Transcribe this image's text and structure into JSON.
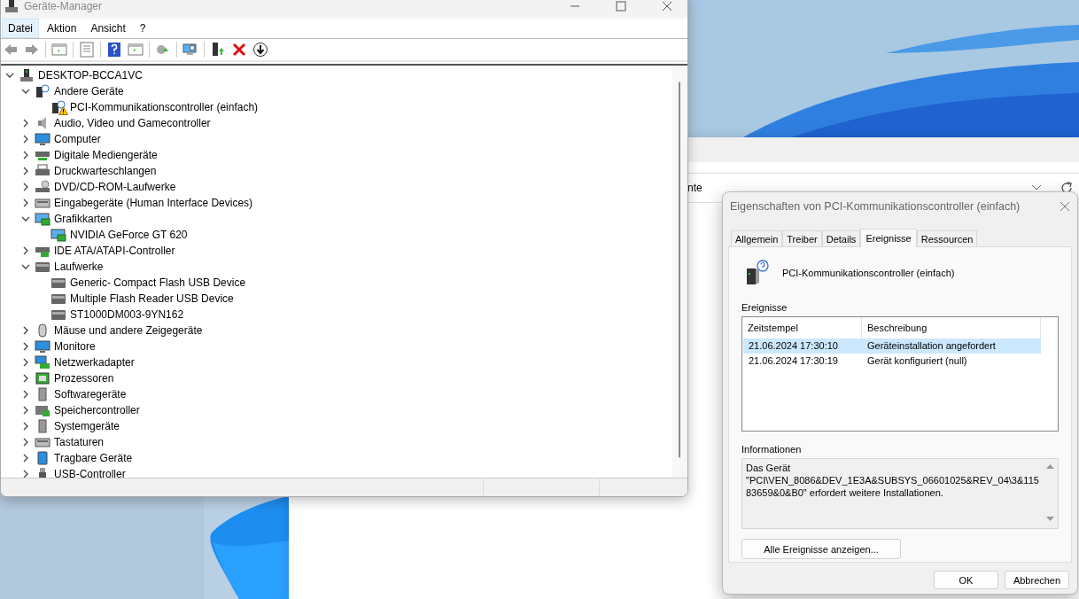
{
  "device_manager": {
    "title": "Geräte-Manager",
    "menu": [
      {
        "label": "Datei",
        "selected": true
      },
      {
        "label": "Aktion",
        "selected": false
      },
      {
        "label": "Ansicht",
        "selected": false
      },
      {
        "label": "?",
        "selected": false
      }
    ],
    "tree": {
      "label": "DESKTOP-BCCA1VC",
      "expanded": true,
      "children": [
        {
          "label": "Andere Geräte",
          "expanded": true,
          "children": [
            {
              "label": "PCI-Kommunikationscontroller (einfach)",
              "warning": true
            }
          ]
        },
        {
          "label": "Audio, Video und Gamecontroller",
          "expanded": false
        },
        {
          "label": "Computer",
          "expanded": false
        },
        {
          "label": "Digitale Mediengeräte",
          "expanded": false
        },
        {
          "label": "Druckwarteschlangen",
          "expanded": false
        },
        {
          "label": "DVD/CD-ROM-Laufwerke",
          "expanded": false
        },
        {
          "label": "Eingabegeräte (Human Interface Devices)",
          "expanded": false
        },
        {
          "label": "Grafikkarten",
          "expanded": true,
          "children": [
            {
              "label": "NVIDIA GeForce GT 620",
              "warning": false
            }
          ]
        },
        {
          "label": "IDE ATA/ATAPI-Controller",
          "expanded": false
        },
        {
          "label": "Laufwerke",
          "expanded": true,
          "children": [
            {
              "label": "Generic- Compact Flash USB Device",
              "warning": false
            },
            {
              "label": "Multiple Flash Reader USB Device",
              "warning": false
            },
            {
              "label": "ST1000DM003-9YN162",
              "warning": false
            }
          ]
        },
        {
          "label": "Mäuse und andere Zeigegeräte",
          "expanded": false
        },
        {
          "label": "Monitore",
          "expanded": false
        },
        {
          "label": "Netzwerkadapter",
          "expanded": false
        },
        {
          "label": "Prozessoren",
          "expanded": false
        },
        {
          "label": "Softwaregeräte",
          "expanded": false
        },
        {
          "label": "Speichercontroller",
          "expanded": false
        },
        {
          "label": "Systemgeräte",
          "expanded": false
        },
        {
          "label": "Tastaturen",
          "expanded": false
        },
        {
          "label": "Tragbare Geräte",
          "expanded": false
        },
        {
          "label": "USB-Controller",
          "expanded": false
        }
      ]
    }
  },
  "background_window": {
    "field_text": "nte"
  },
  "properties_dialog": {
    "title": "Eigenschaften von PCI-Kommunikationscontroller (einfach)",
    "tabs": [
      {
        "label": "Allgemein",
        "selected": false
      },
      {
        "label": "Treiber",
        "selected": false
      },
      {
        "label": "Details",
        "selected": false
      },
      {
        "label": "Ereignisse",
        "selected": true
      },
      {
        "label": "Ressourcen",
        "selected": false
      }
    ],
    "device_name": "PCI-Kommunikationscontroller (einfach)",
    "events_label": "Ereignisse",
    "events_table": {
      "columns": [
        "Zeitstempel",
        "Beschreibung"
      ],
      "rows": [
        {
          "cells": [
            "21.06.2024 17:30:10",
            "Geräteinstallation angefordert"
          ],
          "selected": true
        },
        {
          "cells": [
            "21.06.2024 17:30:19",
            "Gerät konfiguriert (null)"
          ],
          "selected": false
        }
      ]
    },
    "info_label": "Informationen",
    "info_text": "Das Gerät \"PCI\\VEN_8086&DEV_1E3A&SUBSYS_06601025&REV_04\\3&11583659&0&B0\" erfordert weitere Installationen.",
    "all_events_button": "Alle Ereignisse anzeigen...",
    "buttons": [
      "OK",
      "Abbrechen"
    ]
  }
}
